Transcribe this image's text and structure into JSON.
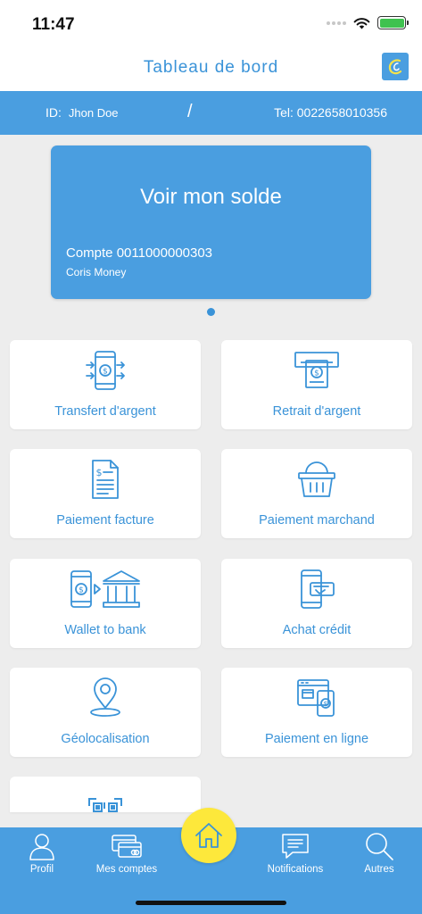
{
  "status": {
    "time": "11:47"
  },
  "nav": {
    "title": "Tableau de bord",
    "logo_icon": "coris-logo-icon"
  },
  "info": {
    "id_label": "ID:",
    "user_name": "Jhon Doe",
    "separator": "/",
    "tel": "Tel: 0022658010356"
  },
  "balance_card": {
    "title": "Voir mon solde",
    "account": "Compte 0011000000303",
    "provider": "Coris Money"
  },
  "tiles": [
    {
      "label": "Transfert d'argent",
      "icon": "phone-transfer-icon"
    },
    {
      "label": "Retrait d'argent",
      "icon": "atm-withdraw-icon"
    },
    {
      "label": "Paiement facture",
      "icon": "invoice-icon"
    },
    {
      "label": "Paiement marchand",
      "icon": "basket-icon"
    },
    {
      "label": "Wallet to bank",
      "icon": "wallet-to-bank-icon"
    },
    {
      "label": "Achat crédit",
      "icon": "phone-credit-icon"
    },
    {
      "label": "Géolocalisation",
      "icon": "location-pin-icon"
    },
    {
      "label": "Paiement en ligne",
      "icon": "online-payment-icon"
    },
    {
      "label": "",
      "icon": "qr-code-icon"
    }
  ],
  "tabs": {
    "profil": "Profil",
    "comptes": "Mes comptes",
    "notifications": "Notifications",
    "autres": "Autres"
  },
  "colors": {
    "primary": "#4a9ee0",
    "accent_text": "#3a93d8",
    "home": "#fde83b",
    "background": "#ededed"
  }
}
